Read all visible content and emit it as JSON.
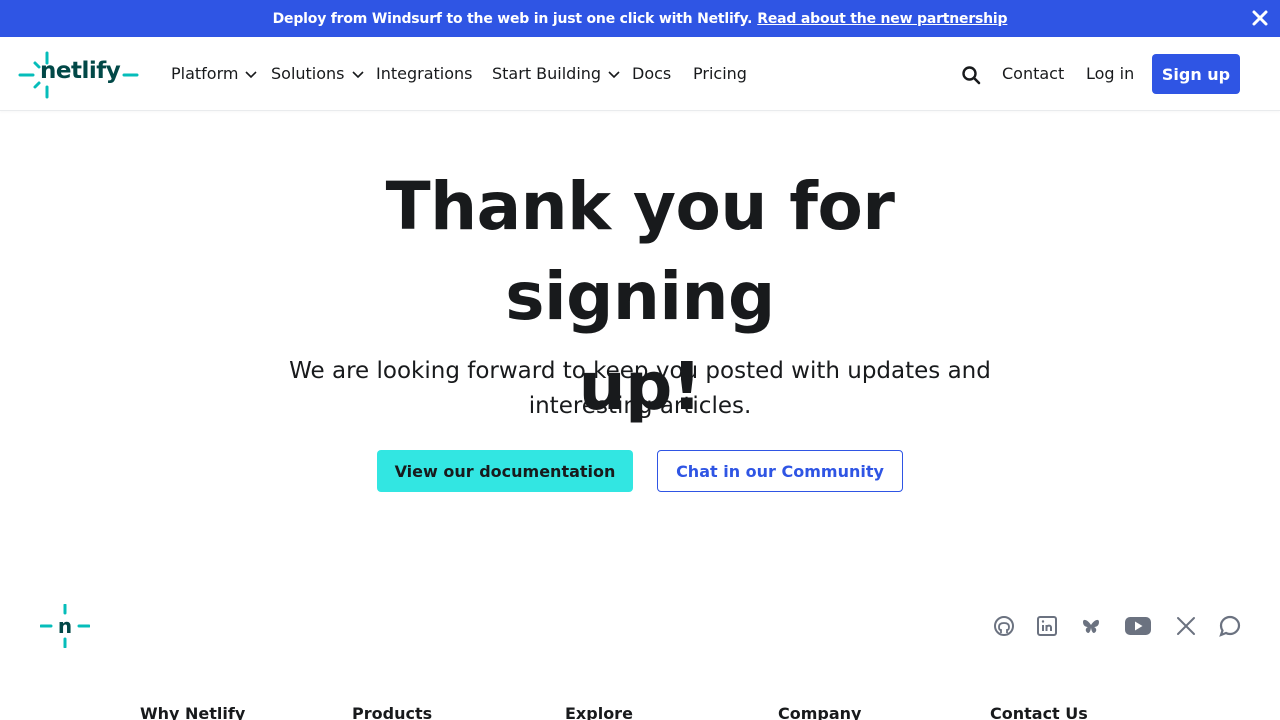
{
  "announcement": {
    "text": "Deploy from Windsurf to the web in just one click with Netlify.",
    "link": "Read about the new partnership",
    "close_icon": "close-icon"
  },
  "header": {
    "logo_text": "netlify",
    "nav": [
      {
        "label": "Platform",
        "has_dropdown": true
      },
      {
        "label": "Solutions",
        "has_dropdown": true
      },
      {
        "label": "Integrations",
        "has_dropdown": false
      },
      {
        "label": "Start Building",
        "has_dropdown": true
      },
      {
        "label": "Docs",
        "has_dropdown": false
      },
      {
        "label": "Pricing",
        "has_dropdown": false
      }
    ],
    "search_icon": "search-icon",
    "contact": "Contact",
    "login": "Log in",
    "signup": "Sign up"
  },
  "hero": {
    "title_line1": "Thank you for signing",
    "title_line2": "up!",
    "subtitle_line1": "We are looking forward to keep you posted with updates and",
    "subtitle_line2": "interesting articles.",
    "primary_button": "View our documentation",
    "secondary_button": "Chat in our Community"
  },
  "footer": {
    "logo_letter": "n",
    "social_icons": [
      "github-icon",
      "linkedin-icon",
      "bluesky-icon",
      "youtube-icon",
      "x-icon",
      "forum-icon"
    ],
    "columns": [
      "Why Netlify",
      "Products",
      "Explore",
      "Company",
      "Contact Us"
    ]
  },
  "colors": {
    "brand_blue": "#2f55e4",
    "teal": "#32e6e2",
    "logo_teal": "#05bdba",
    "logo_dark": "#014847",
    "icon_gray": "#6b7280"
  }
}
